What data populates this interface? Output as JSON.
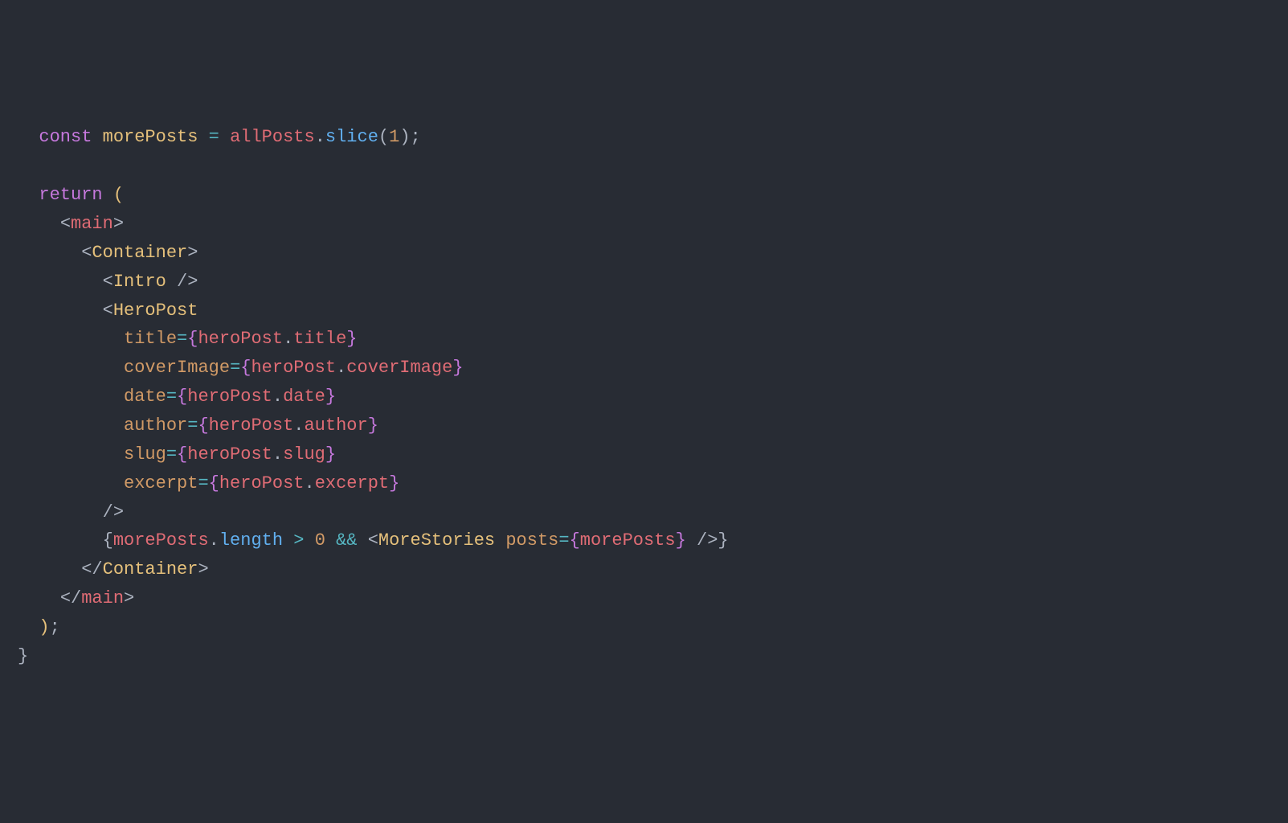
{
  "code": {
    "indent1": "  ",
    "indent2": "    ",
    "indent3": "      ",
    "indent4": "        ",
    "indent5": "          ",
    "kw_const": "const",
    "kw_return": "return",
    "sp": " ",
    "morePosts": "morePosts",
    "eq": "=",
    "allPosts": "allPosts",
    "dot": ".",
    "slice": "slice",
    "lparen": "(",
    "rparen": ")",
    "one": "1",
    "zero": "0",
    "semi": ";",
    "lt": "<",
    "gt": ">",
    "ltslash": "</",
    "slashgt": "/>",
    "main": "main",
    "Container": "Container",
    "Intro": "Intro",
    "HeroPost": "HeroPost",
    "MoreStories": "MoreStories",
    "title_attr": "title",
    "coverImage_attr": "coverImage",
    "date_attr": "date",
    "author_attr": "author",
    "slug_attr": "slug",
    "excerpt_attr": "excerpt",
    "posts_attr": "posts",
    "lbrace": "{",
    "rbrace": "}",
    "heroPost": "heroPost",
    "title_prop": "title",
    "coverImage_prop": "coverImage",
    "date_prop": "date",
    "author_prop": "author",
    "slug_prop": "slug",
    "excerpt_prop": "excerpt",
    "length_prop": "length",
    "gt_op": ">",
    "and_op": "&&",
    "close_brace": "}"
  }
}
